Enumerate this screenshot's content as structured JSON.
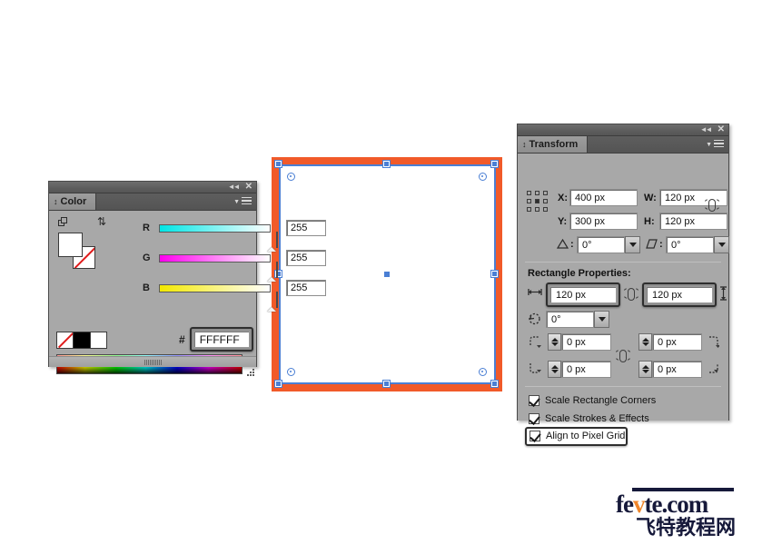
{
  "app": {
    "canvas_background": "#ffffff"
  },
  "color_panel": {
    "tab_label": "Color",
    "collapse_icon": "double-chevron-left-icon",
    "close_icon": "close-icon",
    "menu_icon": "panel-menu-icon",
    "fill_color": "#FFFFFF",
    "stroke_color": "none",
    "sliders": [
      {
        "label": "R",
        "value": "255",
        "track_from": "#00ffff",
        "track_to": "#ffffff"
      },
      {
        "label": "G",
        "value": "255",
        "track_from": "#ff00ff",
        "track_to": "#ffffff"
      },
      {
        "label": "B",
        "value": "255",
        "track_from": "#ffff00",
        "track_to": "#ffffff"
      }
    ],
    "swatches": [
      {
        "name": "none-swatch",
        "color": "none"
      },
      {
        "name": "black-swatch",
        "color": "#000000"
      },
      {
        "name": "white-swatch",
        "color": "#ffffff"
      }
    ],
    "hex_label": "#",
    "hex_value": "FFFFFF",
    "hex_highlighted": true
  },
  "transform_panel": {
    "tab_label": "Transform",
    "collapse_icon": "double-chevron-left-icon",
    "close_icon": "close-icon",
    "menu_icon": "panel-menu-icon",
    "reference_point": "center",
    "fields": {
      "x_label": "X:",
      "x_value": "400 px",
      "y_label": "Y:",
      "y_value": "300 px",
      "w_label": "W:",
      "w_value": "120 px",
      "h_label": "H:",
      "h_value": "120 px",
      "angle_value": "0°",
      "shear_value": "0°"
    },
    "constrain_wh": "broken-link-icon",
    "section_title": "Rectangle Properties:",
    "rect": {
      "width_value": "120 px",
      "height_value": "120 px",
      "rotation_value": "0°",
      "corner_top_left": "0 px",
      "corner_top_right": "0 px",
      "corner_bottom_left": "0 px",
      "corner_bottom_right": "0 px",
      "width_highlighted": true,
      "height_highlighted": true
    },
    "checkboxes": [
      {
        "label": "Scale Rectangle Corners",
        "checked": true,
        "highlighted": false
      },
      {
        "label": "Scale Strokes & Effects",
        "checked": true,
        "highlighted": false
      },
      {
        "label": "Align to Pixel Grid",
        "checked": true,
        "highlighted": true
      }
    ]
  },
  "artwork": {
    "shape": "rectangle",
    "fill": "#ffffff",
    "stroke": "#f15a29",
    "selection_color": "#4a7fd4",
    "selected": true
  },
  "watermark": {
    "line1_a": "fe",
    "line1_v": "v",
    "line1_b": "te.com",
    "line2": "飞特教程网",
    "accent": "#f0862a",
    "dark": "#16193a"
  }
}
